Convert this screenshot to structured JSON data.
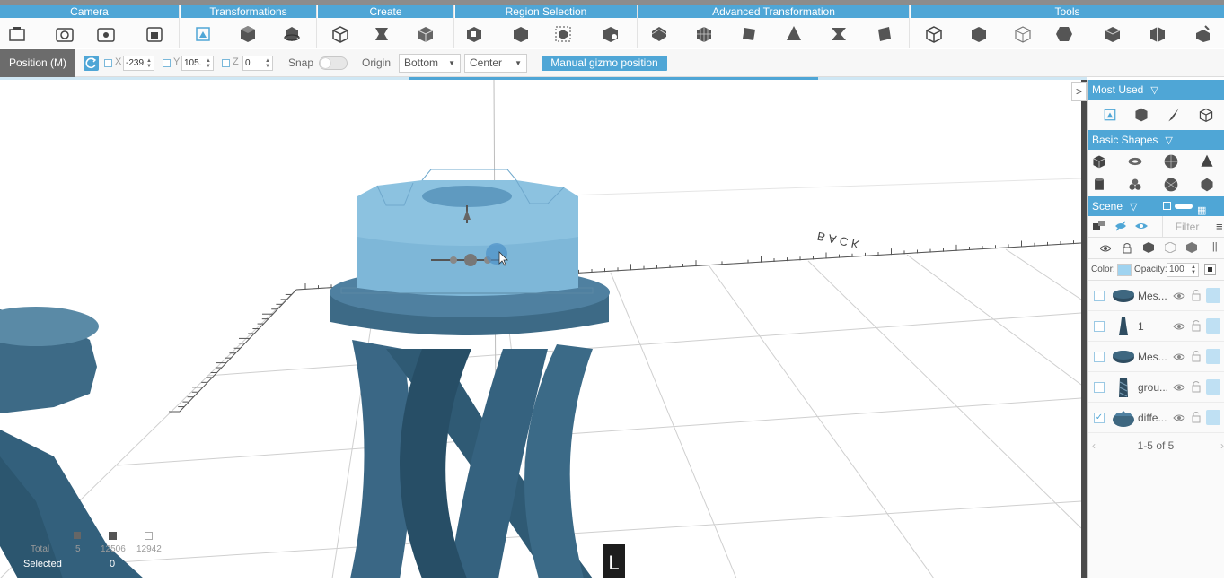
{
  "ribbon": {
    "groups": [
      {
        "title": "Camera",
        "tools": [
          "camera-front-icon",
          "camera-snapshot-icon",
          "camera-settings-icon",
          "camera-reset-icon"
        ]
      },
      {
        "title": "Transformations",
        "tools": [
          "select-move-icon",
          "scale-icon",
          "rotate-icon"
        ]
      },
      {
        "title": "Create",
        "tools": [
          "create-box-icon",
          "create-shape-icon",
          "create-mesh-icon"
        ]
      },
      {
        "title": "Region Selection",
        "tools": [
          "region-select-icon",
          "region-box-icon",
          "region-bounds-icon",
          "region-paint-icon"
        ]
      },
      {
        "title": "Advanced Transformation",
        "tools": [
          "bend-icon",
          "lattice-icon",
          "twist-icon",
          "cone-icon",
          "taper-icon",
          "extrude-icon"
        ]
      },
      {
        "title": "Tools",
        "tools": [
          "inspect-icon",
          "solidify-icon",
          "wireframe-icon",
          "hollow-icon",
          "repair-icon",
          "split-icon",
          "magic-icon"
        ]
      }
    ]
  },
  "options": {
    "mode_label": "Position (M)",
    "x_label": "X",
    "x_value": "-239.",
    "y_label": "Y",
    "y_value": "105.",
    "z_label": "Z",
    "z_value": "0",
    "snap_label": "Snap",
    "snap_on": false,
    "origin_label": "Origin",
    "origin_vertical": "Bottom",
    "origin_horizontal": "Center",
    "gizmo_button": "Manual gizmo position"
  },
  "progress": 0.376,
  "viewport": {
    "axis_text": "BACK",
    "l_badge": "L",
    "stats": {
      "total_label": "Total",
      "total_objects": "5",
      "total_vertices": "12506",
      "total_faces": "12942",
      "selected_label": "Selected",
      "selected_count": "0"
    }
  },
  "panel": {
    "most_used_title": "Most Used",
    "basic_shapes_title": "Basic Shapes",
    "scene_title": "Scene",
    "filter_placeholder": "Filter",
    "color_label": "Color:",
    "opacity_label": "Opacity:",
    "opacity_value": "100",
    "objects": [
      {
        "name": "Mes...",
        "checked": false,
        "thumb": "disc"
      },
      {
        "name": "1",
        "checked": false,
        "thumb": "figure"
      },
      {
        "name": "Mes...",
        "checked": false,
        "thumb": "disc"
      },
      {
        "name": "grou...",
        "checked": false,
        "thumb": "tower"
      },
      {
        "name": "diffe...",
        "checked": true,
        "thumb": "gear"
      }
    ],
    "pager": "1-5 of 5"
  },
  "colors": {
    "accent": "#4fa6d6",
    "model": "#3d6a86",
    "model_selected": "#7eb7d8"
  }
}
